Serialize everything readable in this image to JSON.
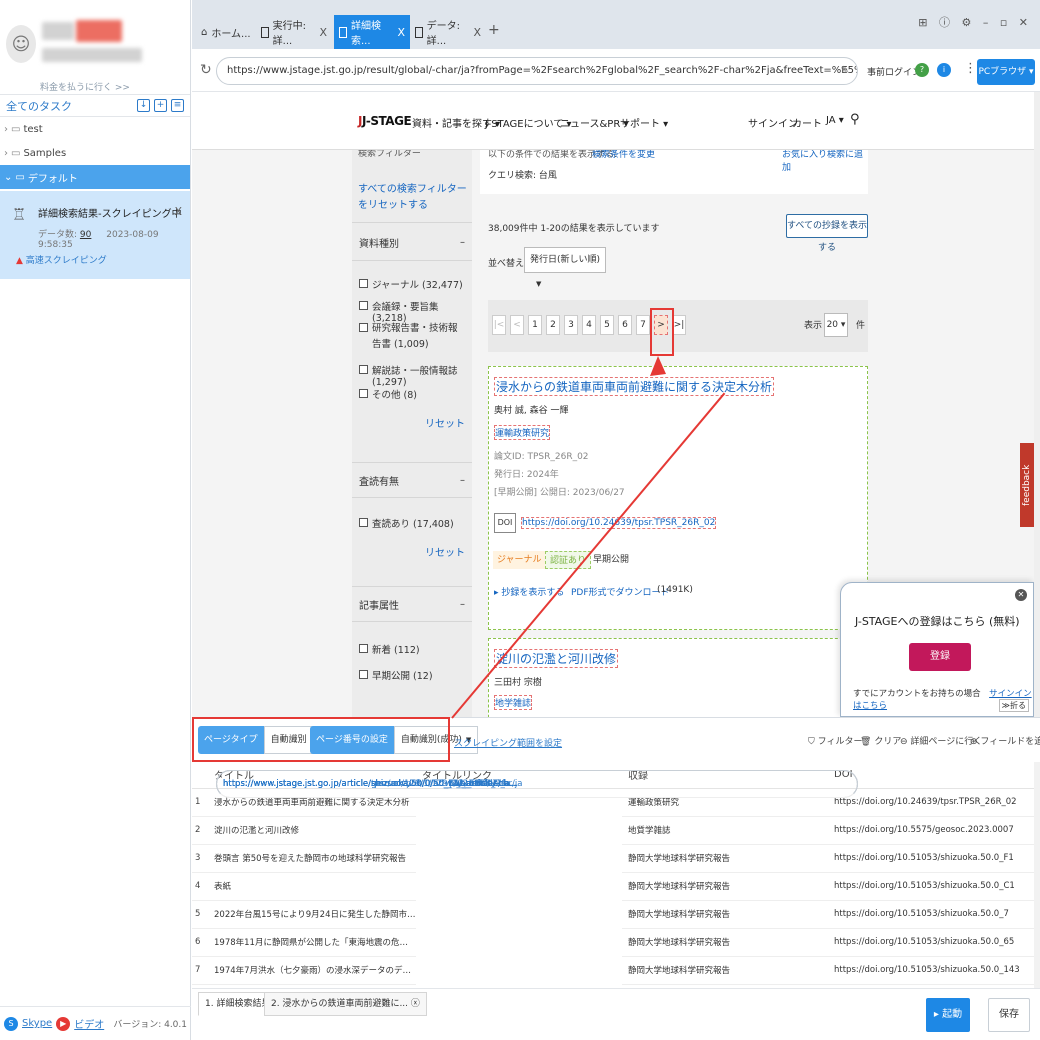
{
  "sidebar": {
    "pay_link": "料金を払うに行く >>",
    "all_tasks": "全てのタスク",
    "folders": [
      {
        "label": "test"
      },
      {
        "label": "Samples"
      },
      {
        "label": "デフォルト"
      }
    ],
    "task": {
      "name": "詳細検索結果-スクレイピング中",
      "data_label": "データ数:",
      "data_count": "90",
      "time": "2023-08-09 9:58:35",
      "mode": "高速スクレイピング"
    },
    "footer": {
      "skype": "Skype",
      "video": "ビデオ",
      "version": "バージョン: 4.0.1"
    }
  },
  "browser": {
    "tabs": [
      {
        "label": "ホーム..."
      },
      {
        "label": "実行中:詳..."
      },
      {
        "label": "詳細検索..."
      },
      {
        "label": "データ:詳..."
      }
    ],
    "url": "https://www.jstage.jst.go.jp/result/global/-char/ja?fromPage=%2Fsearch%2Fglobal%2F_search%2F-char%2Fja&freeText=%E5%8F%B0%E9%A2%A8&item1=&...",
    "pre_login": "事前ログイン",
    "pc_browser": "PCブラウザ"
  },
  "jstage": {
    "logo": "J-STAGE",
    "nav": [
      "資料・記事を探す ▾",
      "J-STAGEについて ▾",
      "ニュース&PR ▾",
      "サポート ▾"
    ],
    "signin": "サインイン",
    "cart": "カート",
    "lang": "JA ▾",
    "query_notice": "以下の条件での結果を表示する:",
    "query_notice_link": "検索条件を変更",
    "query_fav": "お気に入り検索に追加",
    "query_text": "クエリ検索: 台風",
    "filters_trunc": "検索フィルター",
    "reset_all": "すべての検索フィルターをリセットする",
    "filter_groups": [
      {
        "title": "資料種別",
        "items": [
          "ジャーナル (32,477)",
          "会議録・要旨集 (3,218)",
          "研究報告書・技術報告書 (1,009)",
          "解説誌・一般情報誌 (1,297)",
          "その他 (8)"
        ],
        "reset": "リセット"
      },
      {
        "title": "査読有無",
        "items": [
          "査読あり (17,408)"
        ],
        "reset": "リセット"
      },
      {
        "title": "記事属性",
        "items": [
          "新着 (112)",
          "早期公開 (12)"
        ]
      }
    ],
    "result_count": "38,009件中 1-20の結果を表示しています",
    "show_all_abstracts": "すべての抄録を表示する",
    "sort_label": "並べ替え",
    "sort_value": "発行日(新しい順)",
    "pager": [
      "|<",
      "<",
      "1",
      "2",
      "3",
      "4",
      "5",
      "6",
      "7",
      ">",
      ">|"
    ],
    "per_page_label": "表示",
    "per_page_value": "20 ▾",
    "per_page_unit": "件",
    "results": [
      {
        "title": "浸水からの鉄道車両車両前避難に関する決定木分析",
        "authors": "奥村 誠, 森谷 一輝",
        "journal": "運輸政策研究",
        "article_id": "論文ID: TPSR_26R_02",
        "published": "発行日: 2024年",
        "early": "[早期公開] 公開日: 2023/06/27",
        "doi_badge": "DOI",
        "doi": "https://doi.org/10.24639/tpsr.TPSR_26R_02",
        "tags": [
          "ジャーナル",
          "認証あり",
          "早期公開"
        ],
        "abstract_link": "抄録を表示する",
        "pdf_link": "PDF形式でダウンロード",
        "pdf_size": "(1491K)"
      },
      {
        "title": "淀川の氾濫と河川改修",
        "authors": "三田村 宗樹",
        "journal": "地学雑誌"
      }
    ],
    "feedback": "feedback",
    "popup": {
      "title": "J-STAGEへの登録はこちら (無料)",
      "register": "登録",
      "hint": "すでにアカウントをお持ちの場合",
      "signin": "サインインはこちら",
      "collapse": "≫折る"
    }
  },
  "toolbar": {
    "page_type_label": "ページタイプ",
    "page_type_value": "自動識別",
    "page_num_label": "ページ番号の設定",
    "page_num_value": "自動識別(成功)",
    "scope_link": "スクレイピング範囲を設定",
    "filter": "フィルター",
    "clear": "クリア",
    "goto_detail": "詳細ページに行く",
    "add_field": "フィールドを追加"
  },
  "table": {
    "columns": [
      "タイトル",
      "タイトルリンク",
      "収録",
      "DOI"
    ],
    "rows": [
      [
        "1",
        "浸水からの鉄道車両車両前避難に関する決定木分析",
        "https://www.jstage.jst.go.jp/article/tpsr/advpub/0/advpub_TPSR_26...",
        "運輸政策研究",
        "https://doi.org/10.24639/tpsr.TPSR_26R_02"
      ],
      [
        "2",
        "淀川の氾濫と河川改修",
        "https://www.jstage.jst.go.jp/article/geosoc/129/1/129_2023.0007/_a...",
        "地質学雑誌",
        "https://doi.org/10.5575/geosoc.2023.0007"
      ],
      [
        "3",
        "巻頭言 第50号を迎えた静岡市の地球科学研究報告",
        "https://www.jstage.jst.go.jp/article/shizuoka/50/0/50_F1/_article/-ch...",
        "静岡大学地球科学研究報告",
        "https://doi.org/10.51053/shizuoka.50.0_F1"
      ],
      [
        "4",
        "表紙",
        "https://www.jstage.jst.go.jp/article/shizuoka/50/0/50_C1/_article/-ch...",
        "静岡大学地球科学研究報告",
        "https://doi.org/10.51053/shizuoka.50.0_C1"
      ],
      [
        "5",
        "2022年台風15号により9月24日に発生した静岡市の洪水に関する...",
        "https://www.jstage.jst.go.jp/article/shizuoka/50/0/50_7/_article/-char/ja",
        "静岡大学地球科学研究報告",
        "https://doi.org/10.51053/shizuoka.50.0_7"
      ],
      [
        "6",
        "1978年11月に静岡県が公開した「東海地震の危険度の評価」のデ...",
        "https://www.jstage.jst.go.jp/article/shizuoka/50/0/50_65/_article/-ch...",
        "静岡大学地球科学研究報告",
        "https://doi.org/10.51053/shizuoka.50.0_65"
      ],
      [
        "7",
        "1974年7月洪水（七夕豪雨）の浸水深データのデジタル化ならびに...",
        "https://www.jstage.jst.go.jp/article/shizuoka/50/0/50_143/_article/-c...",
        "静岡大学地球科学研究報告",
        "https://doi.org/10.51053/shizuoka.50.0_143"
      ]
    ]
  },
  "bottom": {
    "tabs": [
      "1. 詳細検索結果",
      "2. 浸水からの鉄道車両前避難に..."
    ],
    "run": "起動",
    "save": "保存"
  }
}
